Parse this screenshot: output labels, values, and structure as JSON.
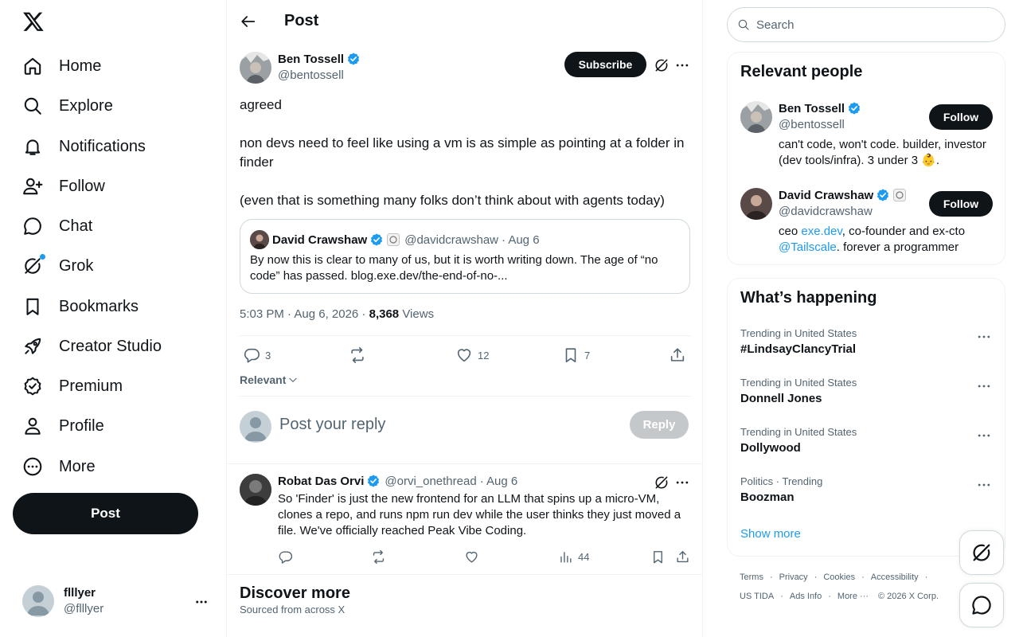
{
  "nav": {
    "items": [
      {
        "label": "Home",
        "icon": "home-icon"
      },
      {
        "label": "Explore",
        "icon": "search-icon"
      },
      {
        "label": "Notifications",
        "icon": "bell-icon"
      },
      {
        "label": "Follow",
        "icon": "person-plus-icon"
      },
      {
        "label": "Chat",
        "icon": "chat-bubble-icon"
      },
      {
        "label": "Grok",
        "icon": "grok-icon"
      },
      {
        "label": "Bookmarks",
        "icon": "bookmark-icon"
      },
      {
        "label": "Creator Studio",
        "icon": "rocket-icon"
      },
      {
        "label": "Premium",
        "icon": "verified-badge-icon"
      },
      {
        "label": "Profile",
        "icon": "person-icon"
      },
      {
        "label": "More",
        "icon": "more-circle-icon"
      }
    ],
    "post_label": "Post",
    "account": {
      "name": "flllyer",
      "handle": "@flllyer"
    }
  },
  "header": {
    "title": "Post"
  },
  "tweet": {
    "author_name": "Ben Tossell",
    "author_handle": "@bentossell",
    "subscribe_label": "Subscribe",
    "text": [
      "agreed",
      "non devs need to feel like using a vm is as simple as pointing at a folder in finder",
      "(even that is something many folks don’t think about with agents today)"
    ],
    "quote": {
      "author_name": "David Crawshaw",
      "author_handle": "@davidcrawshaw",
      "date": "· Aug 6",
      "text": "By now this is clear to many of us, but it is worth writing down. The age of “no code” has passed. blog.exe.dev/the-end-of-no-..."
    },
    "time": "5:03 PM · Aug 6, 2026 ·",
    "views_count": "8,368",
    "views_label": "Views",
    "replies": "3",
    "likes": "12",
    "bookmarks": "7",
    "sort_label": "Relevant"
  },
  "reply_box": {
    "placeholder": "Post your reply",
    "button": "Reply"
  },
  "reply": {
    "author_name": "Robat Das Orvi",
    "author_handle": "@orvi_onethread",
    "date": "· Aug 6",
    "text": "So 'Finder' is just the new frontend for an LLM that spins up a micro-VM, clones a repo, and runs npm run dev while the user thinks they just moved a file. We've officially reached Peak Vibe Coding.",
    "views": "44"
  },
  "discover": {
    "title": "Discover more",
    "subtitle": "Sourced from across X"
  },
  "search": {
    "placeholder": "Search"
  },
  "relevant_people": {
    "title": "Relevant people",
    "follow_label": "Follow",
    "people": [
      {
        "name": "Ben Tossell",
        "handle": "@bentossell",
        "bio": "can't code, won't code. builder, investor (dev tools/infra). 3 under 3 👶."
      },
      {
        "name": "David Crawshaw",
        "handle": "@davidcrawshaw",
        "bio_pre": "ceo ",
        "bio_link1": "exe.dev",
        "bio_mid": ", co-founder and ex-cto ",
        "bio_link2": "@Tailscale",
        "bio_post": ". forever a programmer"
      }
    ]
  },
  "happening": {
    "title": "What’s happening",
    "trends": [
      {
        "context": "Trending in United States",
        "name": "#LindsayClancyTrial"
      },
      {
        "context": "Trending in United States",
        "name": "Donnell Jones"
      },
      {
        "context": "Trending in United States",
        "name": "Dollywood"
      },
      {
        "context": "Politics · Trending",
        "name": "Boozman"
      }
    ],
    "show_more": "Show more"
  },
  "footer": {
    "row1": [
      "Terms",
      "Privacy",
      "Cookies",
      "Accessibility"
    ],
    "row2": [
      "US TIDA",
      "Ads Info",
      "More ···",
      "© 2026 X Corp."
    ]
  },
  "colors": {
    "accent": "#1d9bf0",
    "text": "#0f1419",
    "muted": "#536471",
    "border": "#eff3f4"
  }
}
